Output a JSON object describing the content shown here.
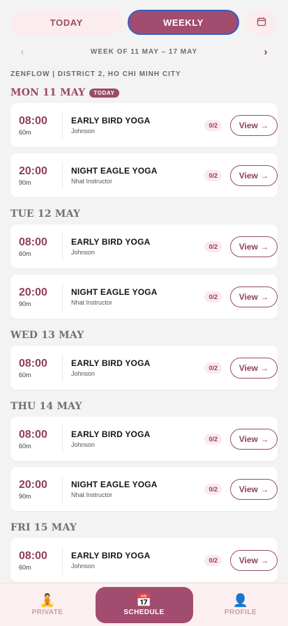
{
  "tabs": {
    "today": "TODAY",
    "weekly": "WEEKLY",
    "calendar_icon": "calendar-icon"
  },
  "week_nav": {
    "prev": "‹",
    "label": "WEEK OF 11 MAY – 17 MAY",
    "next": "›"
  },
  "location": "ZENFLOW | DISTRICT 2, HO CHI MINH CITY",
  "days": [
    {
      "label": "MON 11 MAY",
      "badge": "TODAY",
      "classes": [
        {
          "time": "08:00",
          "duration": "60m",
          "name": "EARLY BIRD YOGA",
          "instructor": "Johnson",
          "capacity": "0/2",
          "action": "View →"
        },
        {
          "time": "20:00",
          "duration": "90m",
          "name": "NIGHT EAGLE YOGA",
          "instructor": "Nhat Instructor",
          "capacity": "0/2",
          "action": "View →"
        }
      ]
    },
    {
      "label": "TUE 12 MAY",
      "classes": [
        {
          "time": "08:00",
          "duration": "60m",
          "name": "EARLY BIRD YOGA",
          "instructor": "Johnson",
          "capacity": "0/2",
          "action": "View →"
        },
        {
          "time": "20:00",
          "duration": "90m",
          "name": "NIGHT EAGLE YOGA",
          "instructor": "Nhat Instructor",
          "capacity": "0/2",
          "action": "View →"
        }
      ]
    },
    {
      "label": "WED 13 MAY",
      "classes": [
        {
          "time": "08:00",
          "duration": "60m",
          "name": "EARLY BIRD YOGA",
          "instructor": "Johnson",
          "capacity": "0/2",
          "action": "View →"
        }
      ]
    },
    {
      "label": "THU 14 MAY",
      "classes": [
        {
          "time": "08:00",
          "duration": "60m",
          "name": "EARLY BIRD YOGA",
          "instructor": "Johnson",
          "capacity": "0/2",
          "action": "View →"
        },
        {
          "time": "20:00",
          "duration": "90m",
          "name": "NIGHT EAGLE YOGA",
          "instructor": "Nhat Instructor",
          "capacity": "0/2",
          "action": "View →"
        }
      ]
    },
    {
      "label": "FRI 15 MAY",
      "classes": [
        {
          "time": "08:00",
          "duration": "60m",
          "name": "EARLY BIRD YOGA",
          "instructor": "Johnson",
          "capacity": "0/2",
          "action": "View →"
        }
      ]
    }
  ],
  "bottom_nav": [
    {
      "label": "PRIVATE",
      "icon": "🧘"
    },
    {
      "label": "SCHEDULE",
      "icon": "📅"
    },
    {
      "label": "PROFILE",
      "icon": "👤"
    }
  ],
  "colors": {
    "accent": "#a24d6f",
    "accent_text": "#8f3e5e",
    "tab_bg": "#fbeced",
    "background": "#f4f3f3"
  }
}
